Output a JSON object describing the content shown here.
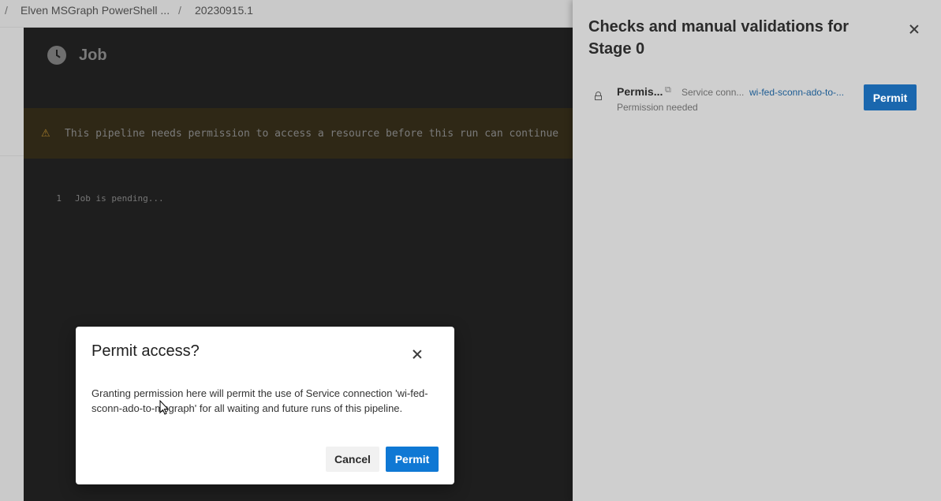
{
  "breadcrumb": {
    "separator": "/",
    "items": [
      "Elven MSGraph PowerShell ...",
      "20230915.1"
    ]
  },
  "job": {
    "title": "Job",
    "warning": "This pipeline needs permission to access a resource before this run can continue",
    "log_lines": [
      {
        "number": "1",
        "text": "Job is pending..."
      }
    ]
  },
  "side_panel": {
    "title": "Checks and manual validations for Stage 0",
    "check": {
      "name": "Permis...",
      "status": "Permission needed",
      "resource_type": "Service conn...",
      "resource_name": "wi-fed-sconn-ado-to-...",
      "permit_label": "Permit"
    }
  },
  "modal": {
    "title": "Permit access?",
    "body": "Granting permission here will permit the use of Service connection 'wi-fed-sconn-ado-to-msgraph' for all waiting and future runs of this pipeline.",
    "cancel_label": "Cancel",
    "permit_label": "Permit"
  },
  "colors": {
    "primary": "#0f78d4",
    "link": "#1d5c93",
    "warning": "#a27a2a"
  }
}
